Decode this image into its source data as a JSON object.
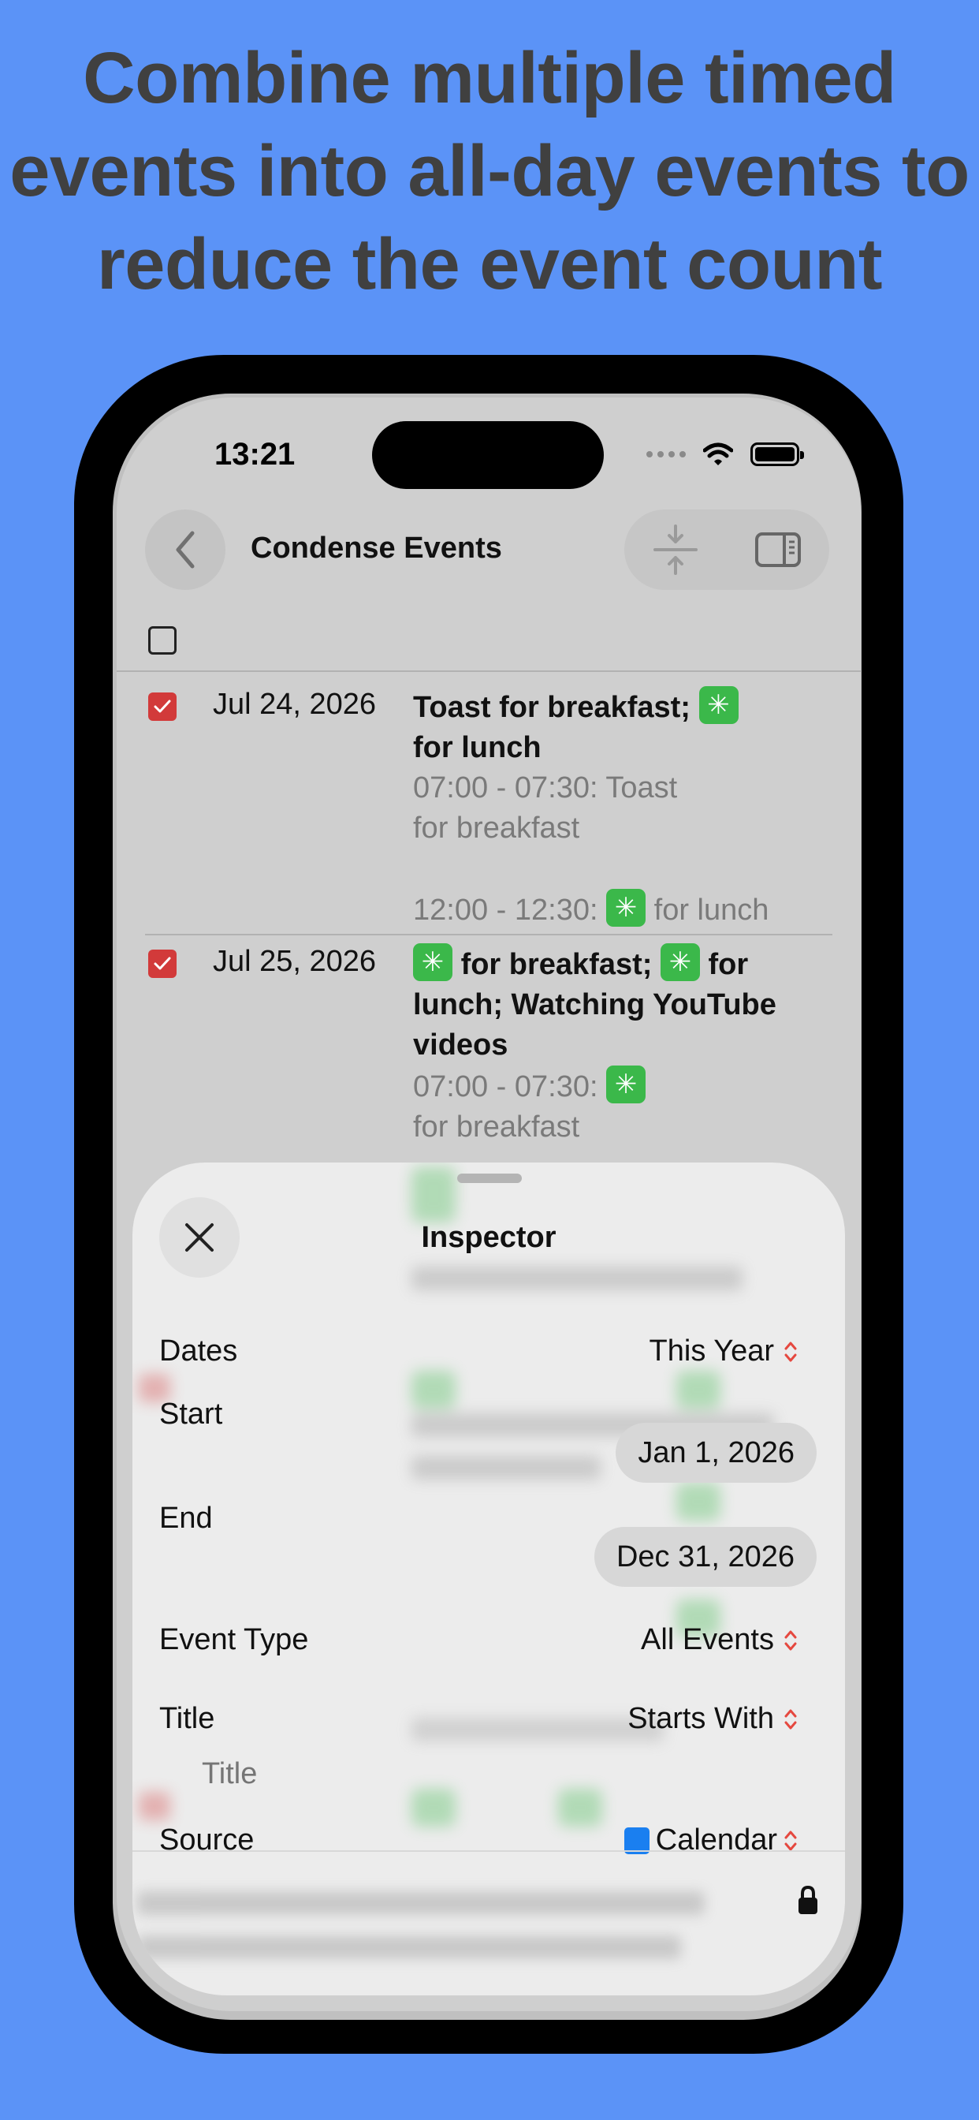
{
  "headline": [
    "Combine multiple timed",
    "events into all-day events to",
    "reduce the event count"
  ],
  "status": {
    "time": "13:21"
  },
  "nav": {
    "title": "Condense Events"
  },
  "rows": [
    {
      "date": "Jul 24, 2026",
      "title_l1_a": "Toast for breakfast;",
      "title_l2": "for lunch",
      "detail_l1": "07:00 - 07:30: Toast",
      "detail_l2": "for breakfast",
      "detail_l3_a": "12:00 - 12:30:",
      "detail_l3_b": "for lunch"
    },
    {
      "date": "Jul 25, 2026",
      "title_l1_b": "for breakfast;",
      "title_l1_c": "for",
      "title_l2": "lunch; Watching YouTube",
      "title_l3": "videos",
      "detail_l1": "07:00 - 07:30:",
      "detail_l2": "for breakfast"
    }
  ],
  "inspector": {
    "title": "Inspector",
    "dates_label": "Dates",
    "dates_value": "This Year",
    "start_label": "Start",
    "start_value": "Jan 1, 2026",
    "end_label": "End",
    "end_value": "Dec 31, 2026",
    "event_type_label": "Event Type",
    "event_type_value": "All Events",
    "title_label": "Title",
    "title_value": "Starts With",
    "title_placeholder": "Title",
    "source_label": "Source",
    "source_value": "Calendar"
  },
  "colors": {
    "background": "#5b93f7",
    "checkbox_checked": "#d23a3a",
    "emoji_green": "#3bb84a",
    "accent_red": "#e5483f",
    "calendar_blue": "#1a7ff0"
  }
}
